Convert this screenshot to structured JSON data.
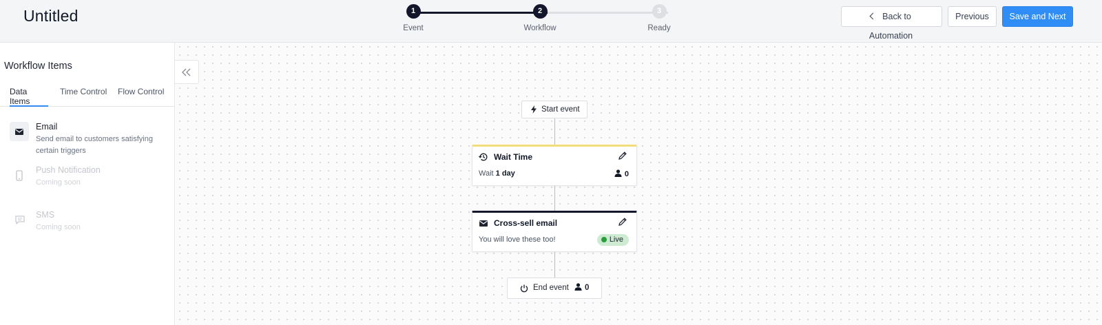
{
  "app": {
    "title": "Untitled"
  },
  "stepper": {
    "steps": [
      {
        "number": "1",
        "label": "Event",
        "state": "complete"
      },
      {
        "number": "2",
        "label": "Workflow",
        "state": "current"
      },
      {
        "number": "3",
        "label": "Ready",
        "state": "pending"
      }
    ]
  },
  "header_actions": {
    "back_label": "Back to Automation",
    "previous_label": "Previous",
    "save_label": "Save and Next"
  },
  "sidebar": {
    "title": "Workflow Items",
    "tabs": [
      {
        "label": "Data Items",
        "active": true
      },
      {
        "label": "Time Control",
        "active": false
      },
      {
        "label": "Flow Control",
        "active": false
      }
    ],
    "items": [
      {
        "icon": "mail-icon",
        "name": "Email",
        "description": "Send email to customers satisfying certain triggers",
        "enabled": true
      },
      {
        "icon": "phone-icon",
        "name": "Push Notification",
        "description": "Coming soon",
        "enabled": false
      },
      {
        "icon": "chat-icon",
        "name": "SMS",
        "description": "Coming soon",
        "enabled": false
      }
    ]
  },
  "workflow": {
    "start": {
      "icon": "lightning-icon",
      "label": "Start event"
    },
    "nodes": [
      {
        "type": "wait",
        "icon": "clock-history-icon",
        "title": "Wait Time",
        "subtitle_prefix": "Wait",
        "subtitle_value": "1 day",
        "count": "0",
        "accent": "#f3dc7a"
      },
      {
        "type": "email",
        "icon": "mail-icon",
        "title": "Cross-sell email",
        "subtitle": "You will love these too!",
        "status": "Live",
        "accent": "#14172b",
        "status_color": "#2a9d3c"
      }
    ],
    "end": {
      "icon": "power-icon",
      "label": "End event",
      "count": "0"
    }
  },
  "colors": {
    "primary": "#2f8df5",
    "dark": "#14172b",
    "live_green": "#2a9d3c",
    "wait_yellow": "#f3dc7a"
  }
}
